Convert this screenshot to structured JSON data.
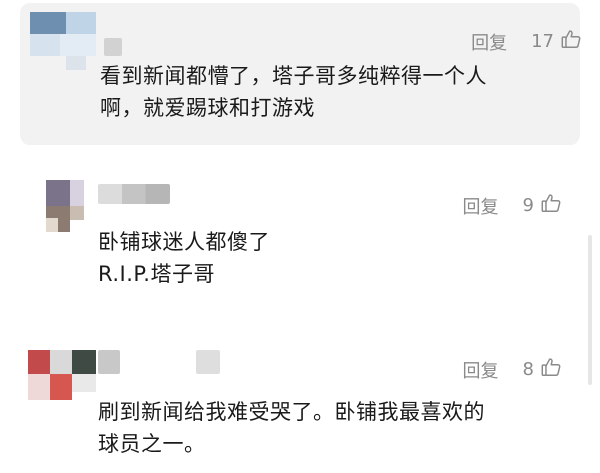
{
  "comments": [
    {
      "reply_label": "回复",
      "like_count": "17",
      "lines": [
        "看到新闻都懵了，塔子哥多纯粹得一个人",
        "啊，就爱踢球和打游戏"
      ]
    },
    {
      "reply_label": "回复",
      "like_count": "9",
      "lines": [
        "卧铺球迷人都傻了",
        "R.I.P.塔子哥"
      ]
    },
    {
      "reply_label": "回复",
      "like_count": "8",
      "lines": [
        "刷到新闻给我难受哭了。卧铺我最喜欢的",
        "球员之一。"
      ]
    }
  ],
  "icons": {
    "like": "thumbs-up-icon"
  },
  "colors": {
    "card_background": "#f2f2f2",
    "meta_text": "#8a8a8a",
    "body_text": "#1a1a1a"
  }
}
